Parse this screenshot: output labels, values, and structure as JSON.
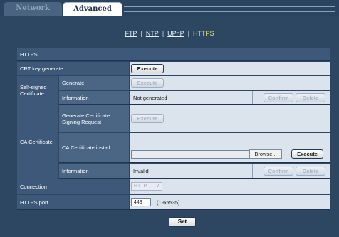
{
  "tabs": [
    {
      "label": "Network"
    },
    {
      "label": "Advanced"
    }
  ],
  "subnav": {
    "links": [
      "FTP",
      "NTP",
      "UPnP"
    ],
    "active": "HTTPS",
    "separator": "|"
  },
  "section_header": "HTTPS",
  "crt_key": {
    "label": "CRT key generate",
    "button": "Execute"
  },
  "self_signed": {
    "label": "Self-signed Certificate",
    "generate_label": "Generate",
    "generate_button": "Execute",
    "information_label": "Information",
    "information_value": "Not generated",
    "confirm_button": "Confirm",
    "delete_button": "Delete"
  },
  "ca_certificate": {
    "label": "CA Certificate",
    "csr_label": "Generate Certificate Signing Request",
    "csr_button": "Execute",
    "install_label": "CA Certificate install",
    "browse_button": "Browse...",
    "install_button": "Execute",
    "information_label": "Information",
    "information_value": "Invalid",
    "confirm_button": "Confirm",
    "delete_button": "Delete"
  },
  "connection": {
    "label": "Connection",
    "value": "HTTP"
  },
  "https_port": {
    "label": "HTTPS port",
    "value": "443",
    "range": "(1-65535)"
  },
  "set_button": "Set"
}
